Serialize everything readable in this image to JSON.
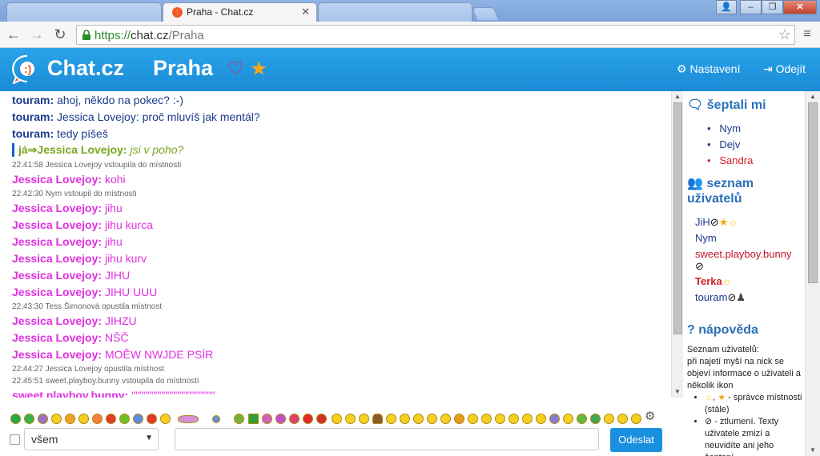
{
  "browser": {
    "tab_title": "Praha - Chat.cz",
    "url_scheme": "https://",
    "url_host": "chat.cz",
    "url_path": "/Praha"
  },
  "header": {
    "brand": "Chat.cz",
    "room": "Praha",
    "settings": "Nastavení",
    "logout": "Odejít"
  },
  "messages": [
    {
      "nick": "touram:",
      "text": "ahoj, někdo na pokec? :-)"
    },
    {
      "nick": "touram:",
      "text": "Jessica Lovejoy: proč mluvíš jak mentál?"
    },
    {
      "nick": "touram:",
      "text": "tedy píšeš"
    },
    {
      "nick": "já⇒Jessica Lovejoy:",
      "text": "jsi v poho?"
    },
    {
      "text": "22:41:58 Jessica Lovejoy vstoupila do místnosti"
    },
    {
      "nick": "Jessica Lovejoy:",
      "text": "kohi"
    },
    {
      "text": "22:42:30 Nym vstoupil do místnosti"
    },
    {
      "nick": "Jessica Lovejoy:",
      "text": "jihu"
    },
    {
      "nick": "Jessica Lovejoy:",
      "text": "jihu kurca"
    },
    {
      "nick": "Jessica Lovejoy:",
      "text": "jihu"
    },
    {
      "nick": "Jessica Lovejoy:",
      "text": "jihu kurv"
    },
    {
      "nick": "Jessica Lovejoy:",
      "text": "JIHU"
    },
    {
      "nick": "Jessica Lovejoy:",
      "text": "JIHU UUU"
    },
    {
      "text": "22:43:30 Tess Šimonová opustila místnost"
    },
    {
      "nick": "Jessica Lovejoy:",
      "text": "JIHZU"
    },
    {
      "nick": "Jessica Lovejoy:",
      "text": "NŠČ"
    },
    {
      "nick": "Jessica Lovejoy:",
      "text": "MOĚW NWJDE PSÍR"
    },
    {
      "text": "22:44:27 Jessica Lovejoy opustila místnost"
    },
    {
      "text": "22:45:51 sweet.playboy.bunny vstoupila do místnosti"
    },
    {
      "nick": "sweet.playboy.bunny:",
      "text": "\"\"\"\"\"\"\"\"\"\"\"\"\"\"\"\"\"\"\"\"\""
    }
  ],
  "panel": {
    "whispers_title": "šeptali mi",
    "whispers": [
      "Nym",
      "Dejv",
      "Sandra"
    ],
    "users_title_1": "seznam",
    "users_title_2": "uživatelů",
    "users": [
      "JiH",
      "Nym",
      "sweet.playboy.bunny",
      "Terka",
      "touram"
    ],
    "help_title": "nápověda",
    "help_intro": "Seznam uživatelů:",
    "help_body": "při najetí myší na nick se objeví informace o uživateli a několik ikon",
    "help_item1": "- správce místnosti (stále)",
    "help_item2": "- ztlumení. Texty uživatele zmizí a neuvidíte ani jeho šeptaní."
  },
  "input": {
    "recipient": "všem",
    "send": "Odeslat"
  },
  "colors": {
    "brand_blue": "#1a8bd6",
    "nick_blue": "#1b3a8c",
    "magenta": "#e030e0",
    "whisper_green": "#7aa520"
  }
}
